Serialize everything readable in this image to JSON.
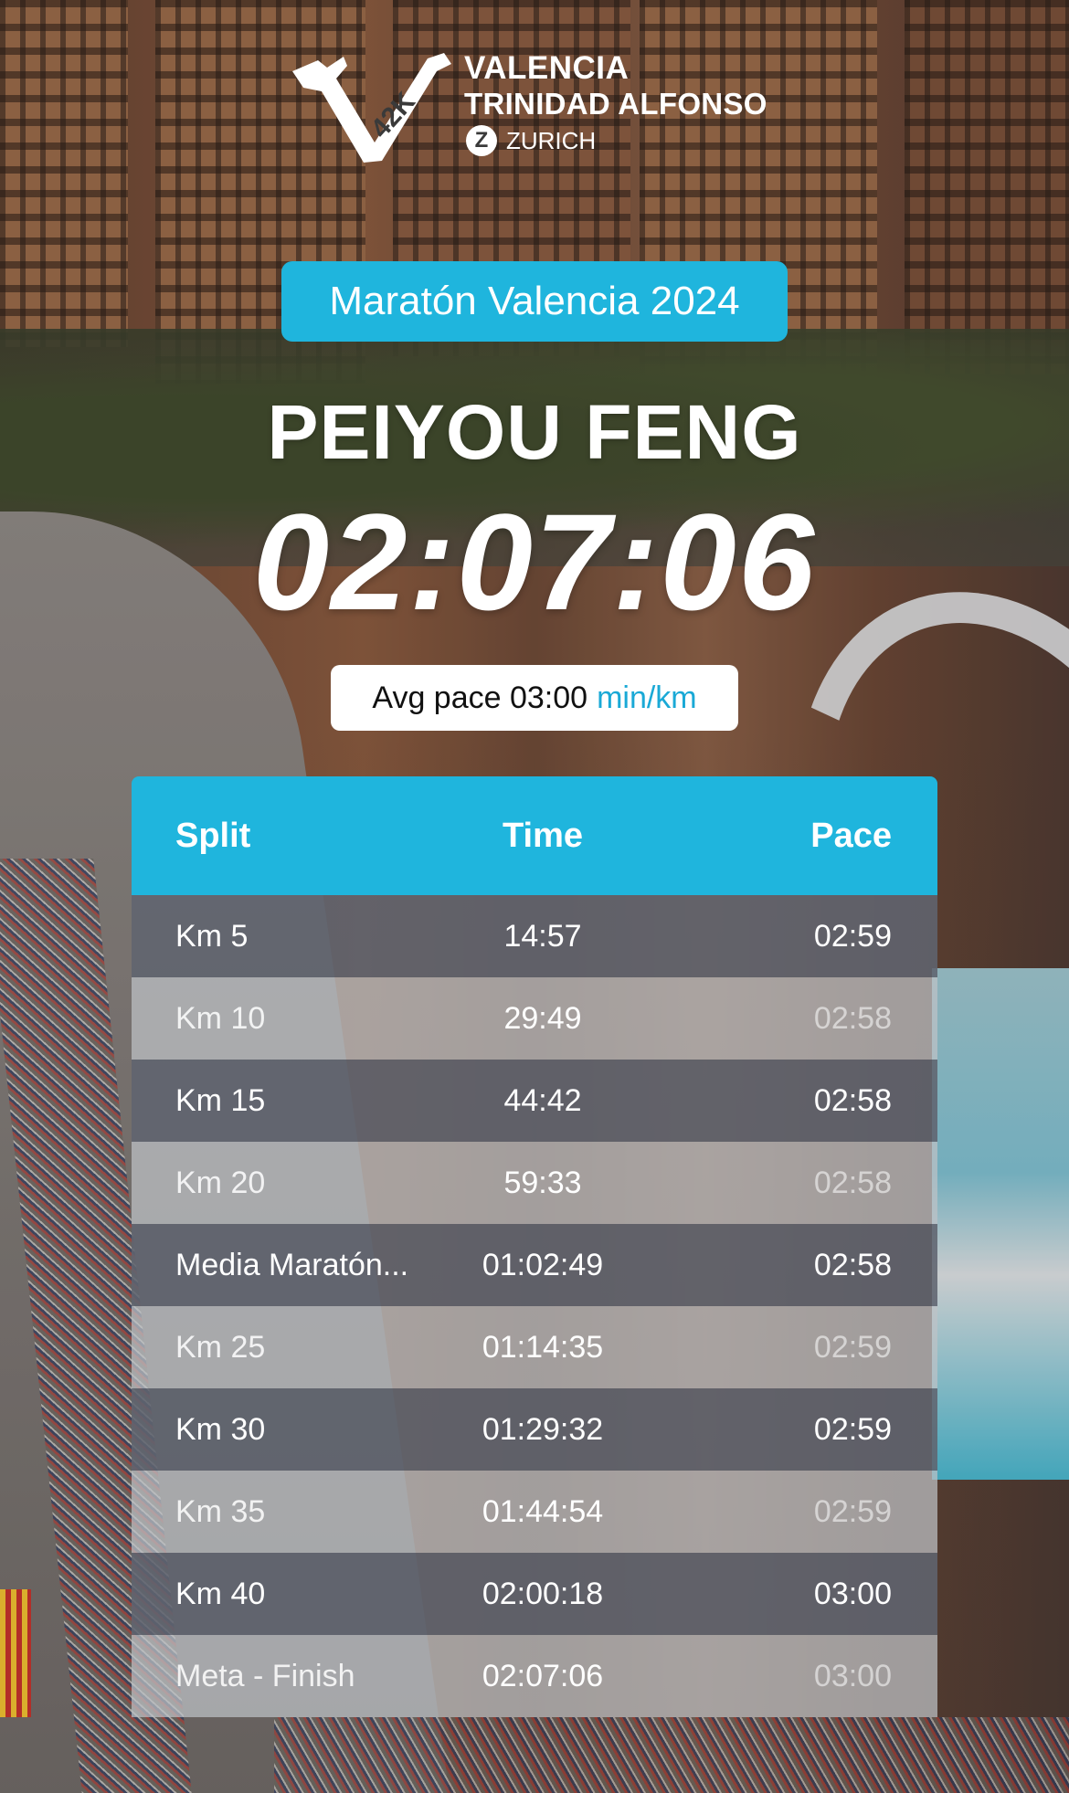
{
  "logo": {
    "line1": "VALENCIA",
    "line2": "TRINIDAD ALFONSO",
    "sponsor": "ZURICH",
    "badge_text": "42K",
    "sponsor_icon": "Z"
  },
  "event": {
    "title": "Maratón Valencia 2024"
  },
  "runner": {
    "name": "PEIYOU FENG",
    "finish_time": "02:07:06",
    "avg_pace_label": "Avg pace 03:00",
    "avg_pace_unit": "min/km"
  },
  "colors": {
    "accent": "#1fb5dd",
    "row_dark": "#606470",
    "row_light": "#bec2c6"
  },
  "splits": {
    "headers": {
      "split": "Split",
      "time": "Time",
      "pace": "Pace"
    },
    "rows": [
      {
        "split": "Km 5",
        "time": "14:57",
        "pace": "02:59"
      },
      {
        "split": "Km 10",
        "time": "29:49",
        "pace": "02:58"
      },
      {
        "split": "Km 15",
        "time": "44:42",
        "pace": "02:58"
      },
      {
        "split": "Km 20",
        "time": "59:33",
        "pace": "02:58"
      },
      {
        "split": "Media Maratón...",
        "time": "01:02:49",
        "pace": "02:58"
      },
      {
        "split": "Km 25",
        "time": "01:14:35",
        "pace": "02:59"
      },
      {
        "split": "Km 30",
        "time": "01:29:32",
        "pace": "02:59"
      },
      {
        "split": "Km 35",
        "time": "01:44:54",
        "pace": "02:59"
      },
      {
        "split": "Km 40",
        "time": "02:00:18",
        "pace": "03:00"
      },
      {
        "split": "Meta - Finish",
        "time": "02:07:06",
        "pace": "03:00"
      }
    ]
  }
}
